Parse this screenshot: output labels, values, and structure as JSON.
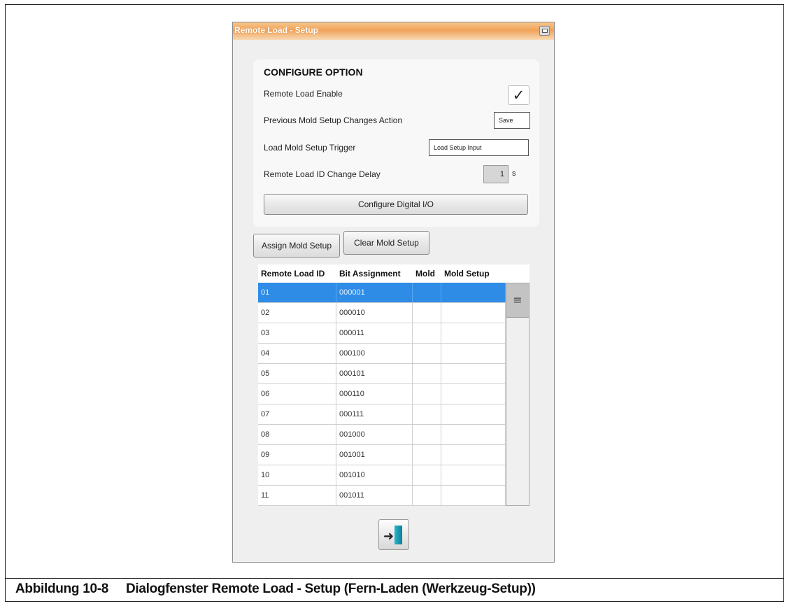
{
  "dialog": {
    "title": "Remote Load - Setup"
  },
  "config": {
    "heading": "CONFIGURE OPTION",
    "remote_enable_label": "Remote Load Enable",
    "remote_enable_checked": true,
    "remote_enable_check_glyph": "✓",
    "prev_action_label": "Previous Mold Setup Changes Action",
    "prev_action_value": "Save",
    "trigger_label": "Load Mold Setup Trigger",
    "trigger_value": "Load Setup Input",
    "delay_label": "Remote Load ID Change Delay",
    "delay_value": "1",
    "delay_unit": "s",
    "configure_io_button": "Configure Digital I/O"
  },
  "actions": {
    "assign_button": "Assign Mold Setup",
    "clear_button": "Clear Mold Setup"
  },
  "table": {
    "columns": [
      "Remote Load ID",
      "Bit Assignment",
      "Mold",
      "Mold Setup"
    ],
    "rows": [
      [
        "01",
        "000001",
        "",
        ""
      ],
      [
        "02",
        "000010",
        "",
        ""
      ],
      [
        "03",
        "000011",
        "",
        ""
      ],
      [
        "04",
        "000100",
        "",
        ""
      ],
      [
        "05",
        "000101",
        "",
        ""
      ],
      [
        "06",
        "000110",
        "",
        ""
      ],
      [
        "07",
        "000111",
        "",
        ""
      ],
      [
        "08",
        "001000",
        "",
        ""
      ],
      [
        "09",
        "001001",
        "",
        ""
      ],
      [
        "10",
        "001010",
        "",
        ""
      ],
      [
        "11",
        "001011",
        "",
        ""
      ]
    ],
    "selected_row": 0,
    "scroll_thumb_glyph": "≡"
  },
  "exit": {
    "icon": "exit-door-icon",
    "arrow_glyph": "➜"
  },
  "caption": {
    "number": "Abbildung 10-8",
    "text": "Dialogfenster Remote Load - Setup (Fern-Laden (Werkzeug-Setup))"
  },
  "colors": {
    "title_bar": "#f0a35a",
    "selected_row": "#2e8ce6",
    "exit_door": "#1a9ab3"
  }
}
